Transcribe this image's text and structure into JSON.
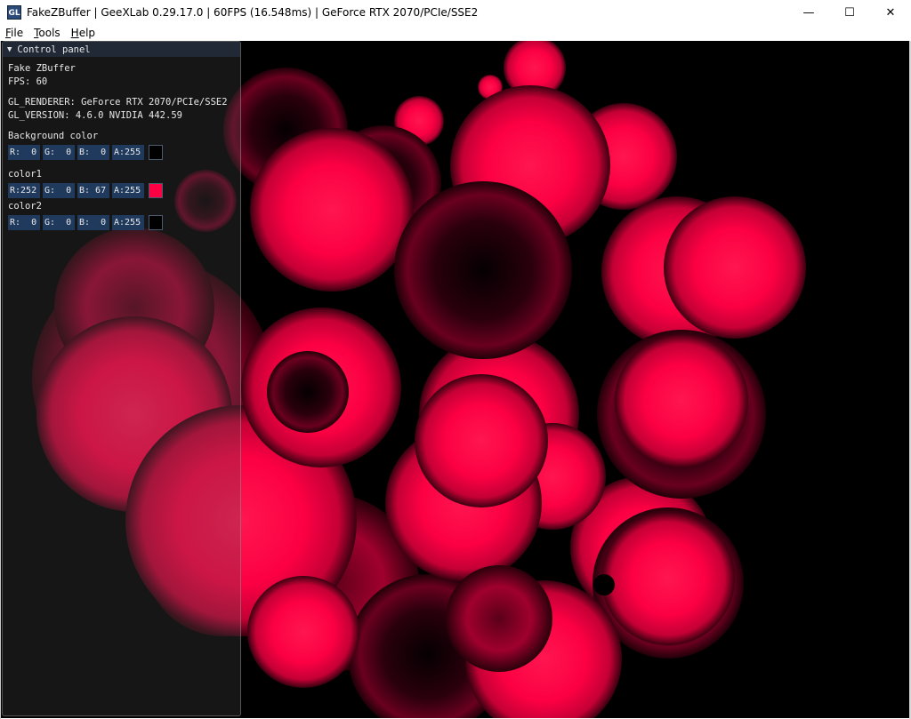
{
  "window": {
    "title": "FakeZBuffer | GeeXLab 0.29.17.0 | 60FPS (16.548ms) | GeForce RTX 2070/PCIe/SSE2",
    "icon_text": "GL",
    "minimize_glyph": "—",
    "maximize_glyph": "☐",
    "close_glyph": "✕"
  },
  "menu": {
    "items": [
      {
        "key": "F",
        "rest": "ile"
      },
      {
        "key": "T",
        "rest": "ools"
      },
      {
        "key": "H",
        "rest": "elp"
      }
    ]
  },
  "panel": {
    "header": "Control panel",
    "collapse_glyph": "▼",
    "demo_name": "Fake ZBuffer",
    "fps": "FPS: 60",
    "renderer": "GL_RENDERER: GeForce RTX 2070/PCIe/SSE2",
    "version": "GL_VERSION: 4.6.0 NVIDIA 442.59",
    "bg_label": "Background color",
    "bg": {
      "r": "R:  0",
      "g": "G:  0",
      "b": "B:  0",
      "a": "A:255",
      "swatch": "#000000"
    },
    "color1_label": "color1",
    "color1": {
      "r": "R:252",
      "g": "G:  0",
      "b": "B: 67",
      "a": "A:255",
      "swatch": "#fc0043"
    },
    "color2_label": "color2",
    "color2": {
      "r": "R:  0",
      "g": "G:  0",
      "b": "B:  0",
      "a": "A:255",
      "swatch": "#000000"
    }
  },
  "colors": {
    "accent": "#fc0043",
    "viewport_bg": "#000000",
    "field_bg": "#1f3a5c"
  }
}
